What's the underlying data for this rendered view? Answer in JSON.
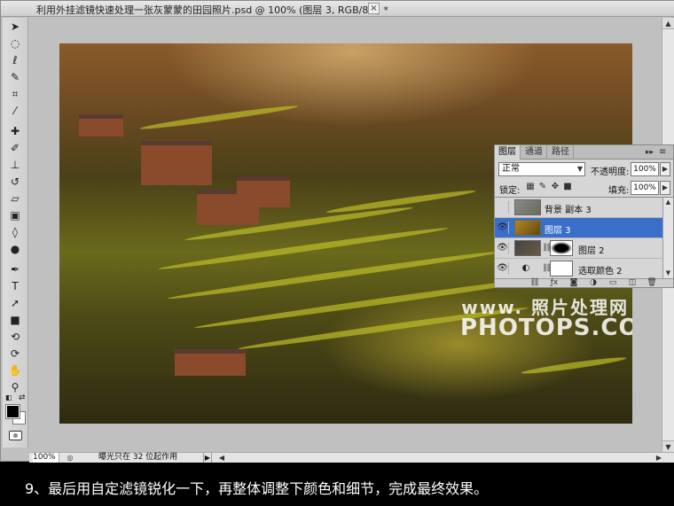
{
  "document": {
    "title": "利用外挂滤镜快速处理一张灰蒙蒙的田园照片.psd @ 100% (图层 3, RGB/8#) *",
    "close_glyph": "×"
  },
  "tools": [
    {
      "name": "move-tool-icon",
      "glyph": "➤"
    },
    {
      "name": "marquee-tool-icon",
      "glyph": "◌"
    },
    {
      "name": "lasso-tool-icon",
      "glyph": "ℓ"
    },
    {
      "name": "quick-select-tool-icon",
      "glyph": "✎"
    },
    {
      "name": "crop-tool-icon",
      "glyph": "⌗"
    },
    {
      "name": "eyedropper-tool-icon",
      "glyph": "⁄"
    },
    {
      "name": "healing-brush-tool-icon",
      "glyph": "✚"
    },
    {
      "name": "brush-tool-icon",
      "glyph": "✐"
    },
    {
      "name": "clone-stamp-tool-icon",
      "glyph": "⊥"
    },
    {
      "name": "history-brush-tool-icon",
      "glyph": "↺"
    },
    {
      "name": "eraser-tool-icon",
      "glyph": "▱"
    },
    {
      "name": "gradient-tool-icon",
      "glyph": "▣"
    },
    {
      "name": "blur-tool-icon",
      "glyph": "◊"
    },
    {
      "name": "dodge-tool-icon",
      "glyph": "●"
    },
    {
      "name": "pen-tool-icon",
      "glyph": "✒"
    },
    {
      "name": "type-tool-icon",
      "glyph": "T"
    },
    {
      "name": "path-select-tool-icon",
      "glyph": "➚"
    },
    {
      "name": "shape-tool-icon",
      "glyph": "■"
    },
    {
      "name": "3d-rotate-tool-icon",
      "glyph": "⟲"
    },
    {
      "name": "3d-orbit-tool-icon",
      "glyph": "⟳"
    },
    {
      "name": "hand-tool-icon",
      "glyph": "✋"
    },
    {
      "name": "zoom-tool-icon",
      "glyph": "⚲"
    }
  ],
  "watermark": {
    "cn": "www. 照片处理网",
    "en": "PHOTOPS.COM"
  },
  "status": {
    "zoom": "100%",
    "message": "曝光只在 32 位起作用",
    "arrow": "▶"
  },
  "layers_panel": {
    "tabs": [
      "图层",
      "通道",
      "路径"
    ],
    "blend_mode": "正常",
    "opacity_label": "不透明度:",
    "opacity": "100%",
    "lock_label": "锁定:",
    "fill_label": "填充:",
    "fill": "100%",
    "layers": [
      {
        "name": "背景 副本 3",
        "visible": false,
        "selected": false
      },
      {
        "name": "图层 3",
        "visible": true,
        "selected": true
      },
      {
        "name": "图层 2",
        "visible": true,
        "selected": false
      },
      {
        "name": "选取颜色 2",
        "visible": true,
        "selected": false
      }
    ]
  },
  "caption": "9、最后用自定滤镜锐化一下，再整体调整下颜色和细节，完成最终效果。"
}
